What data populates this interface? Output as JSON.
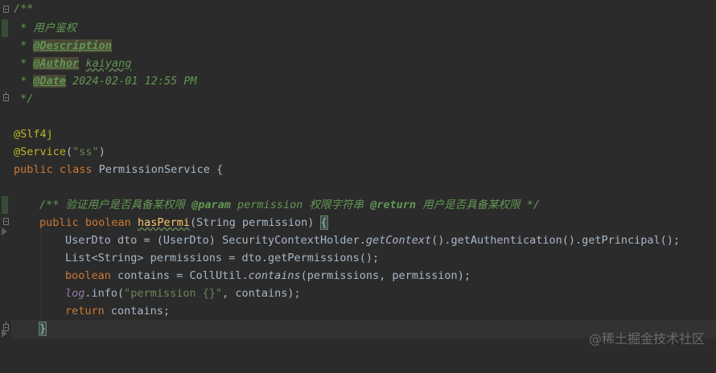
{
  "editor": {
    "lines": {
      "l1": "/**",
      "l2_prefix": " * ",
      "l2_text": "用户鉴权",
      "l3_prefix": " * ",
      "l3_tag": "@Description",
      "l4_prefix": " * ",
      "l4_tag": "@Author",
      "l4_value": "kaiyang",
      "l5_prefix": " * ",
      "l5_tag": "@Date",
      "l5_value": "2024-02-01 12:55 PM",
      "l6": " */",
      "l8_ann": "@Slf4j",
      "l9_ann": "@Service",
      "l9_paren_open": "(",
      "l9_str": "\"ss\"",
      "l9_paren_close": ")",
      "l10_kw": "public class",
      "l10_rest": " PermissionService {",
      "l12_doc1": "/** 验证用户是否具备某权限 ",
      "l12_tag1": "@param",
      "l12_param": " permission",
      "l12_doc2": " 权限字符串 ",
      "l12_tag2": "@return",
      "l12_doc3": " 用户是否具备某权限 */",
      "l13_kw": "public boolean",
      "l13_fn": "hasPermi",
      "l13_args": "(String permission) ",
      "l13_brace": "{",
      "l14_a": "UserDto dto = (UserDto) SecurityContextHolder.",
      "l14_b": "getContext",
      "l14_c": "().getAuthentication().getPrincipal();",
      "l15": "List<String> permissions = dto.getPermissions();",
      "l16_kw": "boolean",
      "l16_a": " contains = CollUtil.",
      "l16_b": "contains",
      "l16_c": "(permissions, permission);",
      "l17_field": "log",
      "l17_a": ".info(",
      "l17_str": "\"permission {}\"",
      "l17_b": ", contains);",
      "l18_kw": "return",
      "l18_a": " contains;",
      "l19_brace": "}"
    }
  },
  "watermark": "@稀土掘金技术社区",
  "colors": {
    "background": "#2b2b2b",
    "keyword": "#cc7832",
    "annotation": "#bbb529",
    "string": "#6a8759",
    "doc_comment": "#629755",
    "method": "#ffc66d",
    "field": "#9876aa",
    "text": "#a9b7c6"
  }
}
